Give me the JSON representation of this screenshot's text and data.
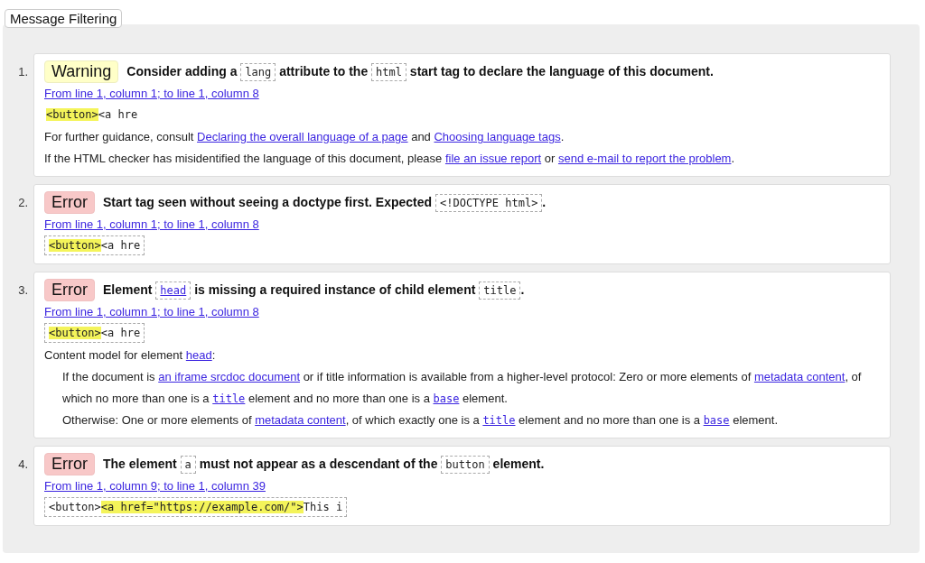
{
  "filter_button": "Message Filtering",
  "messages": [
    {
      "number": "1.",
      "kind": "warning",
      "badge": "Warning",
      "title": [
        {
          "text": "Consider adding a "
        },
        {
          "code": "lang"
        },
        {
          "text": " attribute to the "
        },
        {
          "code": "html"
        },
        {
          "text": " start tag to declare the language of this document."
        }
      ],
      "location": "From line 1, column 1; to line 1, column 8",
      "extract": {
        "bordered": false,
        "highlight": "<button>",
        "after": "<a hre"
      },
      "details": [
        {
          "parts": [
            {
              "text": "For further guidance, consult "
            },
            {
              "link": "Declaring the overall language of a page"
            },
            {
              "text": " and "
            },
            {
              "link": "Choosing language tags"
            },
            {
              "text": "."
            }
          ]
        },
        {
          "parts": [
            {
              "text": "If the HTML checker has misidentified the language of this document, please "
            },
            {
              "link": "file an issue report"
            },
            {
              "text": " or "
            },
            {
              "link": "send e-mail to report the problem"
            },
            {
              "text": "."
            }
          ]
        }
      ]
    },
    {
      "number": "2.",
      "kind": "error",
      "badge": "Error",
      "title": [
        {
          "text": "Start tag seen without seeing a doctype first. Expected "
        },
        {
          "code": "<!DOCTYPE html>"
        },
        {
          "text": "."
        }
      ],
      "location": "From line 1, column 1; to line 1, column 8",
      "extract": {
        "bordered": true,
        "highlight": "<button>",
        "after": "<a hre"
      }
    },
    {
      "number": "3.",
      "kind": "error",
      "badge": "Error",
      "title": [
        {
          "text": "Element "
        },
        {
          "codelink": "head"
        },
        {
          "text": " is missing a required instance of child element "
        },
        {
          "code": "title"
        },
        {
          "text": "."
        }
      ],
      "location": "From line 1, column 1; to line 1, column 8",
      "extract": {
        "bordered": true,
        "highlight": "<button>",
        "after": "<a hre"
      },
      "details": [
        {
          "parts": [
            {
              "text": "Content model for element "
            },
            {
              "link": "head"
            },
            {
              "text": ":"
            }
          ],
          "children": [
            {
              "parts": [
                {
                  "text": "If the document is "
                },
                {
                  "link": "an iframe srcdoc document"
                },
                {
                  "text": " or if title information is available from a higher-level protocol: Zero or more elements of "
                },
                {
                  "link": "metadata content"
                },
                {
                  "text": ", of which no more than one is a "
                },
                {
                  "monolink": "title"
                },
                {
                  "text": " element and no more than one is a "
                },
                {
                  "monolink": "base"
                },
                {
                  "text": " element."
                }
              ]
            },
            {
              "parts": [
                {
                  "text": "Otherwise: One or more elements of "
                },
                {
                  "link": "metadata content"
                },
                {
                  "text": ", of which exactly one is a "
                },
                {
                  "monolink": "title"
                },
                {
                  "text": " element and no more than one is a "
                },
                {
                  "monolink": "base"
                },
                {
                  "text": " element."
                }
              ]
            }
          ]
        }
      ]
    },
    {
      "number": "4.",
      "kind": "error",
      "badge": "Error",
      "title": [
        {
          "text": "The element "
        },
        {
          "code": "a"
        },
        {
          "text": " must not appear as a descendant of the "
        },
        {
          "code": "button"
        },
        {
          "text": " element."
        }
      ],
      "location": "From line 1, column 9; to line 1, column 39",
      "extract": {
        "bordered": true,
        "before": "<button>",
        "highlight": "<a href=\"https://example.com/\">",
        "after": "This i"
      }
    }
  ]
}
